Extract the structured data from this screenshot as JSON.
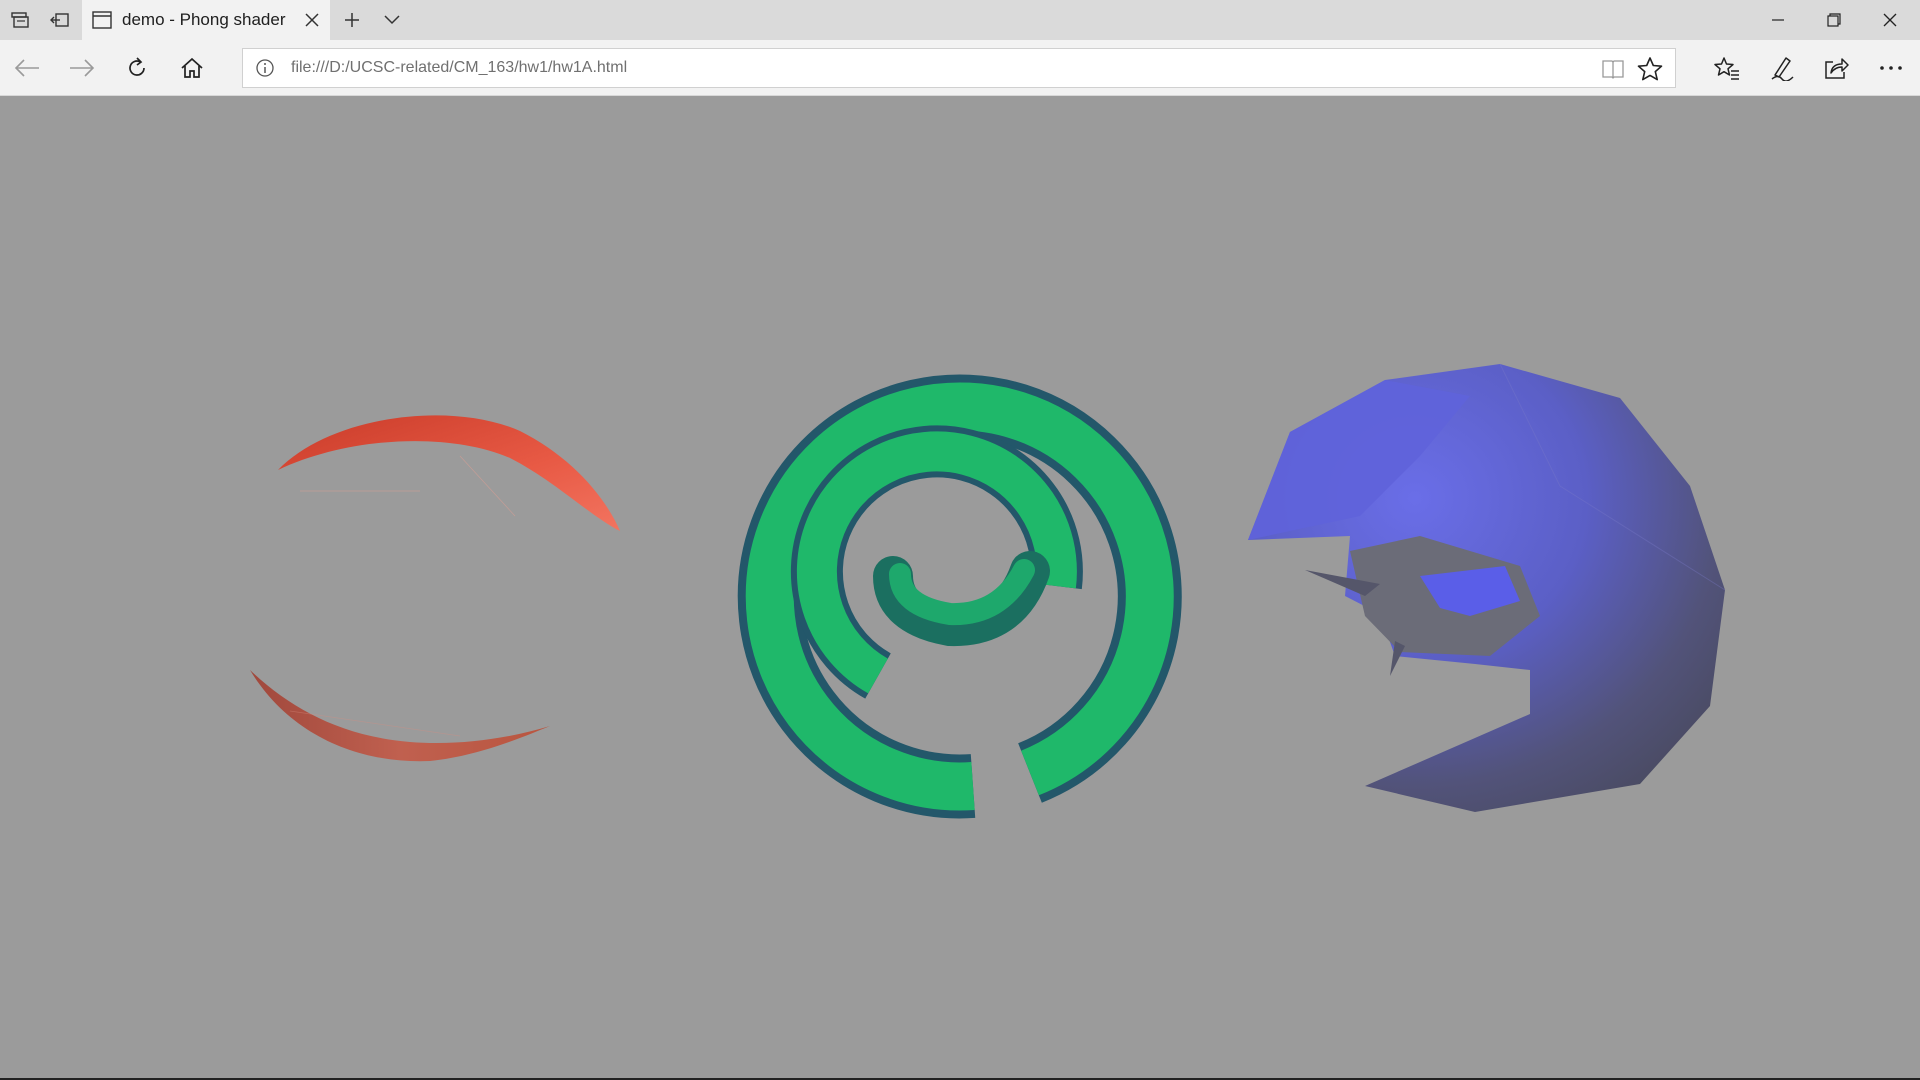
{
  "browser": {
    "tab_title": "demo - Phong shader",
    "address_url": "file:///D:/UCSC-related/CM_163/hw1/hw1A.html"
  },
  "icons": {
    "tab_manager": "tabs-aside-icon",
    "set_aside": "set-tabs-aside-icon",
    "page_tab": "page-icon",
    "close_tab": "close-icon",
    "new_tab": "plus-icon",
    "tab_preview": "chevron-down-icon",
    "minimize": "minimize-icon",
    "restore": "restore-icon",
    "close_window": "close-icon",
    "back": "arrow-left-icon",
    "forward": "arrow-right-icon",
    "refresh": "refresh-icon",
    "home": "home-icon",
    "site_info": "info-icon",
    "reading_view": "book-icon",
    "favorite": "star-icon",
    "favorites_hub": "favorites-list-icon",
    "notes": "pen-icon",
    "share": "share-icon",
    "more": "more-icon"
  },
  "scene": {
    "background": "#9b9b9b",
    "objects": [
      {
        "name": "red-sphere-segments",
        "color": "#d94a36"
      },
      {
        "name": "green-torus-spiral",
        "color": "#1fb86a"
      },
      {
        "name": "blue-rock-shell",
        "color": "#5c5fd0"
      }
    ]
  }
}
